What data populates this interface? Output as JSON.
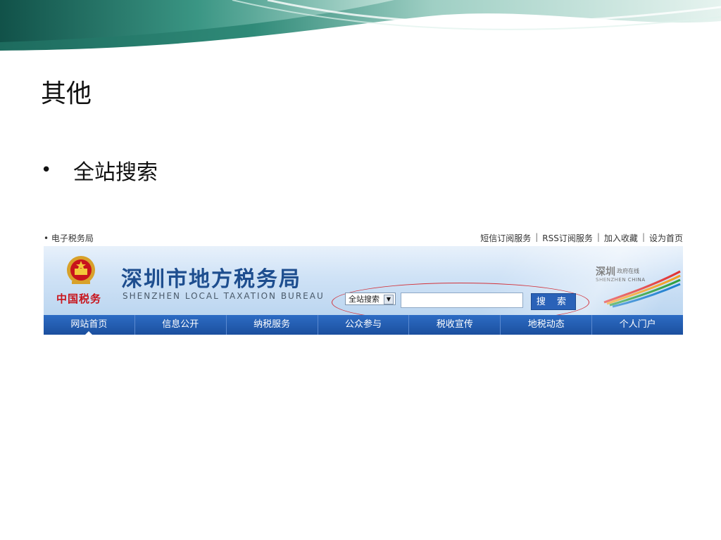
{
  "slide": {
    "title": "其他",
    "bullet": "全站搜索"
  },
  "screenshot": {
    "top_left_link": "• 电子税务局",
    "top_links": [
      "短信订阅服务",
      "RSS订阅服务",
      "加入收藏",
      "设为首页"
    ],
    "separator": "|",
    "emblem_caption": "中国税务",
    "bureau_name_cn": "深圳市地方税务局",
    "bureau_name_en": "SHENZHEN LOCAL TAXATION BUREAU",
    "search": {
      "scope_value": "全站搜索",
      "input_value": "",
      "button_label": "搜 索"
    },
    "shenzhen_logo": {
      "title": "深圳",
      "subtitle": "政府在线",
      "english": "SHENZHEN CHINA"
    },
    "nav": [
      "网站首页",
      "信息公开",
      "纳税服务",
      "公众参与",
      "税收宣传",
      "地税动态",
      "个人门户"
    ],
    "active_nav": "网站首页"
  },
  "colors": {
    "nav_bg": "#1b4f9e",
    "title_blue": "#1e4e8f",
    "highlight_ring": "#d2323a",
    "button_blue": "#2a62b8"
  }
}
